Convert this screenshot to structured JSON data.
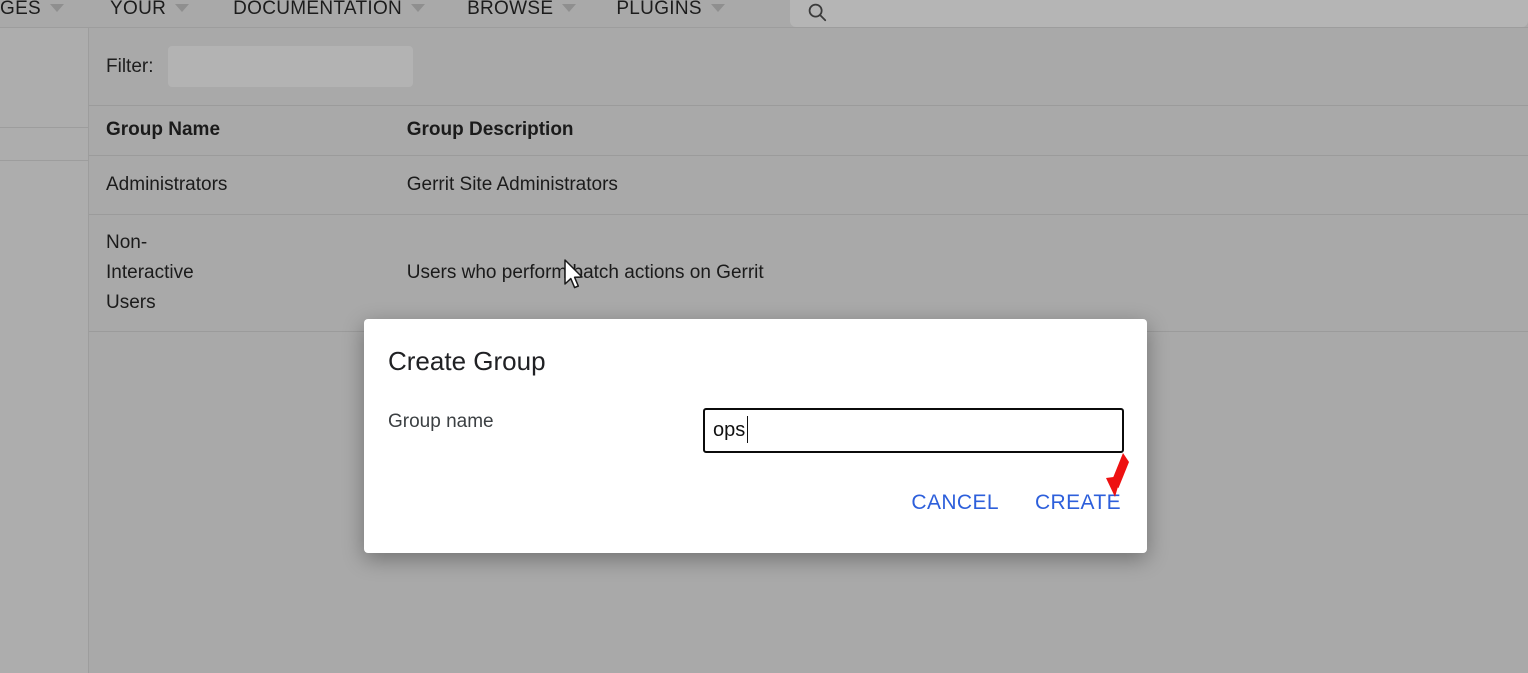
{
  "header": {
    "nav_items": [
      {
        "label": "GES",
        "icon": "chevron-down-icon"
      },
      {
        "label": "YOUR",
        "icon": "chevron-down-icon"
      },
      {
        "label": "DOCUMENTATION",
        "icon": "chevron-down-icon"
      },
      {
        "label": "BROWSE",
        "icon": "chevron-down-icon"
      },
      {
        "label": "PLUGINS",
        "icon": "chevron-down-icon"
      }
    ],
    "search": {
      "icon": "search-icon",
      "value": "",
      "placeholder": ""
    }
  },
  "filter": {
    "label": "Filter:",
    "value": "",
    "placeholder": ""
  },
  "table": {
    "columns": [
      "Group Name",
      "Group Description"
    ],
    "rows": [
      {
        "name": "Administrators",
        "description": "Gerrit Site Administrators"
      },
      {
        "name": "Non-Interactive Users",
        "description": "Users who perform batch actions on Gerrit"
      }
    ]
  },
  "dialog": {
    "title": "Create Group",
    "field_label": "Group name",
    "field_value": "ops",
    "field_placeholder": "",
    "cancel_label": "CANCEL",
    "create_label": "CREATE"
  },
  "annotation": {
    "arrow": "red-arrow-pointing-to-create",
    "color": "#ee1111"
  },
  "colors": {
    "overlay_background": "#a9a9a9",
    "sidebar": "#adadad",
    "dialog_background": "#ffffff",
    "link_blue": "#2d5fdb",
    "text": "#1b1b1b"
  }
}
